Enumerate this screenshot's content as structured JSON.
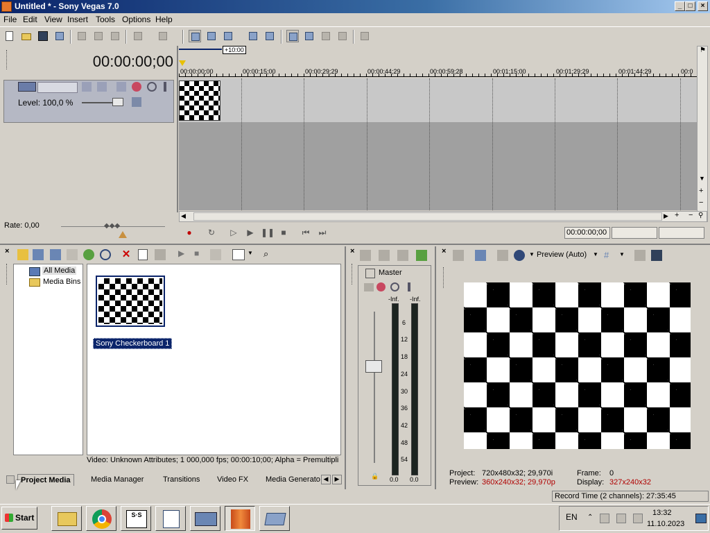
{
  "window": {
    "title": "Untitled * - Sony Vegas 7.0",
    "minimize": "_",
    "maximize": "□",
    "close": "×"
  },
  "menu": [
    "File",
    "Edit",
    "View",
    "Insert",
    "Tools",
    "Options",
    "Help"
  ],
  "timeline": {
    "timecode": "00:00:00;00",
    "marker_label": "+10:00",
    "ruler_ticks": [
      "00:00:00;00",
      "00:00:15;00",
      "00:00:29;29",
      "00:00:44;29",
      "00:00:59;28",
      "00:01:15;00",
      "00:01:29;29",
      "00:01:44;29",
      "00:0"
    ]
  },
  "track": {
    "level_label": "Level: 100,0 %"
  },
  "rate_label": "Rate: 0,00",
  "transport": {
    "position": "00:00:00;00",
    "record": "●",
    "loop": "↻",
    "play_from_start": "▷",
    "play": "▶",
    "pause": "❚❚",
    "stop": "■",
    "go_start": "⏮",
    "go_end": "⏭"
  },
  "explorer": {
    "tree": [
      "All Media",
      "Media Bins"
    ],
    "media_item": "Sony Checkerboard 1",
    "status_info": "Video: Unknown Attributes; 1 000,000 fps; 00:00:10;00; Alpha = Premultipli"
  },
  "tabs": [
    "Project Media",
    "Media Manager",
    "Transitions",
    "Video FX",
    "Media Generato"
  ],
  "mixer": {
    "label": "Master",
    "left_peak": "-Inf.",
    "right_peak": "-Inf.",
    "scale": [
      "6",
      "12",
      "18",
      "24",
      "30",
      "36",
      "42",
      "48",
      "54"
    ],
    "left_value": "0.0",
    "right_value": "0.0"
  },
  "preview": {
    "mode": "Preview (Auto)",
    "project_label": "Project:",
    "project_value": "720x480x32; 29,970i",
    "preview_label": "Preview:",
    "preview_value": "360x240x32; 29,970p",
    "frame_label": "Frame:",
    "frame_value": "0",
    "display_label": "Display:",
    "display_value": "327x240x32"
  },
  "status": {
    "record_time": "Record Time (2 channels): 27:35:45"
  },
  "taskbar": {
    "start": "Start",
    "apps": [
      "file-explorer",
      "chrome",
      "sas-app",
      "wordpad",
      "keyboard-app",
      "sony-vegas",
      "window-app"
    ],
    "lang": "EN",
    "time": "13:32",
    "date": "11.10.2023"
  },
  "colors": {
    "title_start": "#0a246a",
    "title_end": "#a6caf0",
    "track_header": "#b5b8c4",
    "selection": "#0a246a",
    "warning_text": "#b00000"
  }
}
